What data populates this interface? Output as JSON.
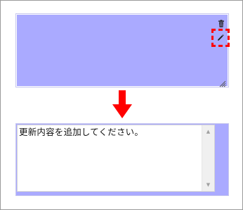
{
  "view_panel": {
    "trash_icon": "trash-icon",
    "edit_icon": "pencil-icon",
    "highlight_color": "#ff0000",
    "fill_color": "#aaaaff"
  },
  "arrow": {
    "color": "#ff0000",
    "icon": "arrow-down-icon"
  },
  "edit_panel": {
    "textarea_value": "更新内容を追加してください。",
    "scroll_up_glyph": "▲",
    "scroll_down_glyph": "▼"
  }
}
